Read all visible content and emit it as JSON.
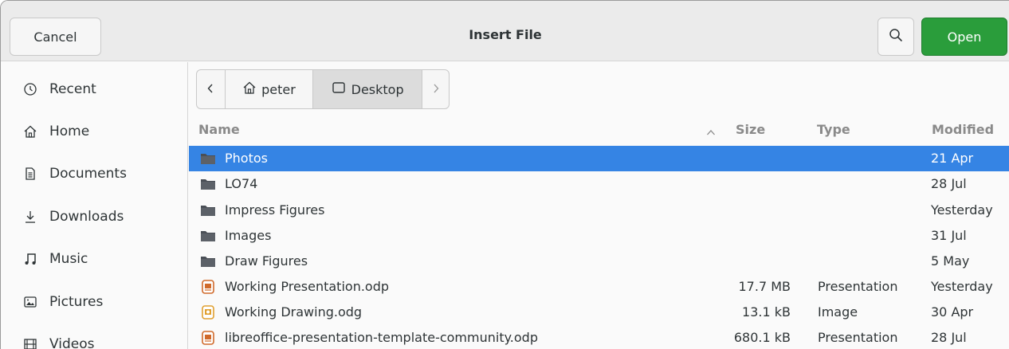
{
  "header": {
    "cancel_label": "Cancel",
    "title": "Insert File",
    "open_label": "Open",
    "search_icon": "search-icon"
  },
  "sidebar": {
    "items": [
      {
        "label": "Recent",
        "icon": "clock-icon"
      },
      {
        "label": "Home",
        "icon": "home-icon"
      },
      {
        "label": "Documents",
        "icon": "document-icon"
      },
      {
        "label": "Downloads",
        "icon": "download-icon"
      },
      {
        "label": "Music",
        "icon": "music-note-icon"
      },
      {
        "label": "Pictures",
        "icon": "picture-icon"
      },
      {
        "label": "Videos",
        "icon": "film-icon"
      }
    ]
  },
  "pathbar": {
    "back_icon": "chevron-left-icon",
    "home_label": "peter",
    "current_label": "Desktop",
    "forward_icon": "chevron-right-icon"
  },
  "columns": {
    "name": "Name",
    "size": "Size",
    "type": "Type",
    "modified": "Modified"
  },
  "files": [
    {
      "name": "Photos",
      "size": "",
      "type": "",
      "modified": "21 Apr",
      "kind": "folder",
      "selected": true
    },
    {
      "name": "LO74",
      "size": "",
      "type": "",
      "modified": "28 Jul",
      "kind": "folder",
      "selected": false
    },
    {
      "name": "Impress Figures",
      "size": "",
      "type": "",
      "modified": "Yesterday",
      "kind": "folder",
      "selected": false
    },
    {
      "name": "Images",
      "size": "",
      "type": "",
      "modified": "31 Jul",
      "kind": "folder",
      "selected": false
    },
    {
      "name": "Draw Figures",
      "size": "",
      "type": "",
      "modified": "5 May",
      "kind": "folder",
      "selected": false
    },
    {
      "name": "Working Presentation.odp",
      "size": "17.7 MB",
      "type": "Presentation",
      "modified": "Yesterday",
      "kind": "presentation",
      "selected": false
    },
    {
      "name": "Working Drawing.odg",
      "size": "13.1 kB",
      "type": "Image",
      "modified": "30 Apr",
      "kind": "drawing",
      "selected": false
    },
    {
      "name": "libreoffice-presentation-template-community.odp",
      "size": "680.1 kB",
      "type": "Presentation",
      "modified": "28 Jul",
      "kind": "presentation",
      "selected": false
    }
  ],
  "colors": {
    "selection": "#3584e4",
    "open_button": "#2a9d3b",
    "folder": "#4a4f56",
    "presentation_icon": "#d06a2b",
    "drawing_icon": "#e0a030"
  }
}
